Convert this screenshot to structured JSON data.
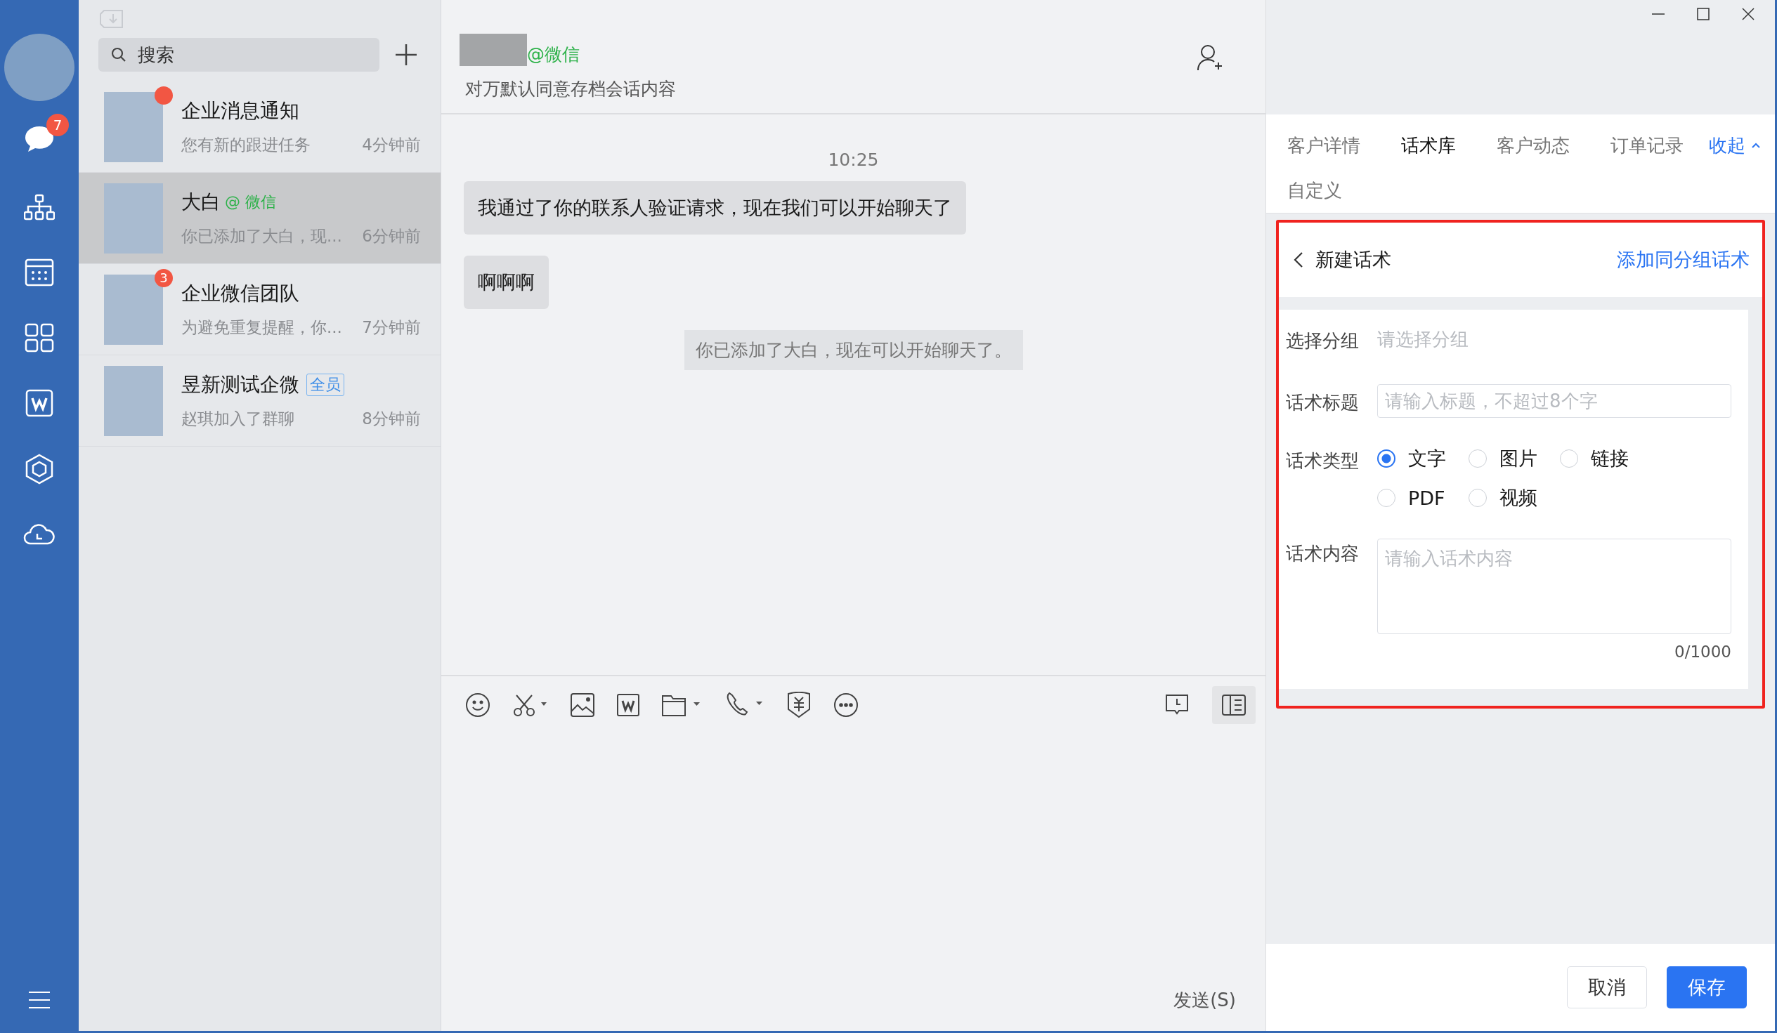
{
  "nav": {
    "chat_badge": "7"
  },
  "chat_list": {
    "search": {
      "placeholder": "搜索"
    },
    "items": [
      {
        "name": "企业消息通知",
        "preview": "您有新的跟进任务",
        "time": "4分钟前",
        "selected": false,
        "unread": true
      },
      {
        "name": "大白",
        "tag": {
          "kind": "wechat",
          "text": "@ 微信"
        },
        "preview": "你已添加了大白，现...",
        "time": "6分钟前",
        "selected": true,
        "unread": false
      },
      {
        "name": "企业微信团队",
        "preview": "为避免重复提醒，你...",
        "time": "7分钟前",
        "selected": false,
        "unread": true,
        "badge": "3"
      },
      {
        "name": "昱新测试企微",
        "tag": {
          "kind": "all",
          "text": "全员"
        },
        "preview": "赵琪加入了群聊",
        "time": "8分钟前",
        "selected": false,
        "unread": false
      }
    ]
  },
  "chat": {
    "header": {
      "source": "@微信",
      "notice": "对万默认同意存档会话内容"
    },
    "messages": [
      {
        "kind": "time",
        "text": "10:25"
      },
      {
        "kind": "bubble",
        "text": "我通过了你的联系人验证请求，现在我们可以开始聊天了"
      },
      {
        "kind": "bubble",
        "text": "啊啊啊"
      },
      {
        "kind": "system",
        "text": "你已添加了大白，现在可以开始聊天了。"
      }
    ],
    "send_label": "发送(S)"
  },
  "side_panel": {
    "tabs": [
      {
        "label": "客户详情",
        "selected": false
      },
      {
        "label": "话术库",
        "selected": true
      },
      {
        "label": "客户动态",
        "selected": false
      },
      {
        "label": "订单记录",
        "selected": false
      },
      {
        "label": "自定义",
        "selected": false
      }
    ],
    "collapse": "收起",
    "form": {
      "title": "新建话术",
      "add_link": "添加同分组话术",
      "group": {
        "label": "选择分组",
        "placeholder": "请选择分组"
      },
      "title_field": {
        "label": "话术标题",
        "placeholder": "请输入标题，不超过8个字"
      },
      "type": {
        "label": "话术类型",
        "options": [
          {
            "label": "文字",
            "selected": true
          },
          {
            "label": "图片",
            "selected": false
          },
          {
            "label": "链接",
            "selected": false
          },
          {
            "label": "PDF",
            "selected": false
          },
          {
            "label": "视频",
            "selected": false
          }
        ]
      },
      "content": {
        "label": "话术内容",
        "placeholder": "请输入话术内容",
        "counter": "0/1000"
      }
    },
    "buttons": {
      "cancel": "取消",
      "save": "保存"
    }
  }
}
